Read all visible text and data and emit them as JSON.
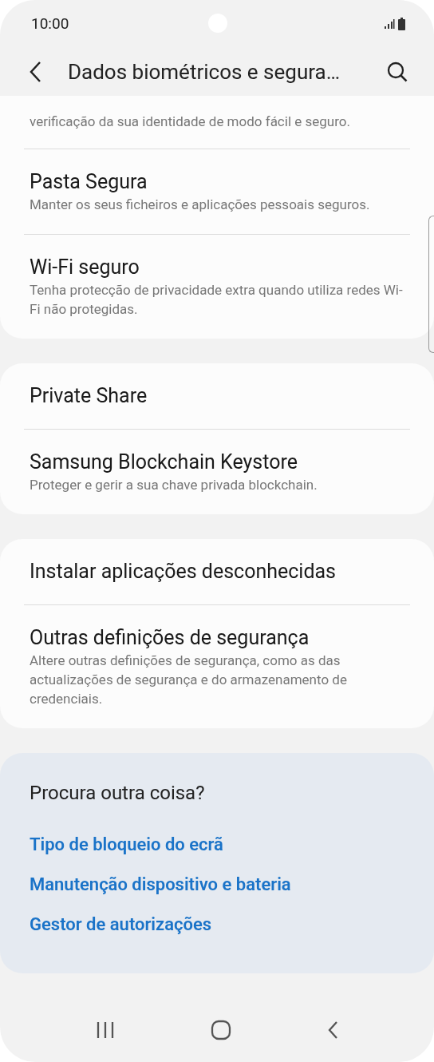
{
  "status_bar": {
    "time": "10:00"
  },
  "header": {
    "title": "Dados biométricos e segura…"
  },
  "sections": [
    {
      "items": [
        {
          "subtitle": "verificação da sua identidade de modo fácil e seguro."
        },
        {
          "title": "Pasta Segura",
          "subtitle": "Manter os seus ficheiros e aplicações pessoais seguros."
        },
        {
          "title": "Wi-Fi seguro",
          "subtitle": "Tenha protecção de privacidade extra quando utiliza redes Wi-Fi não protegidas."
        }
      ]
    },
    {
      "items": [
        {
          "title": "Private Share"
        },
        {
          "title": "Samsung Blockchain Keystore",
          "subtitle": "Proteger e gerir a sua chave privada blockchain."
        }
      ]
    },
    {
      "items": [
        {
          "title": "Instalar aplicações desconhecidas"
        },
        {
          "title": "Outras definições de segurança",
          "subtitle": "Altere outras definições de segurança, como as das actualizações de segurança e do armazenamento de credenciais."
        }
      ]
    }
  ],
  "suggestions": {
    "heading": "Procura outra coisa?",
    "links": [
      "Tipo de bloqueio do ecrã",
      "Manutenção dispositivo e bateria",
      "Gestor de autorizações"
    ]
  }
}
